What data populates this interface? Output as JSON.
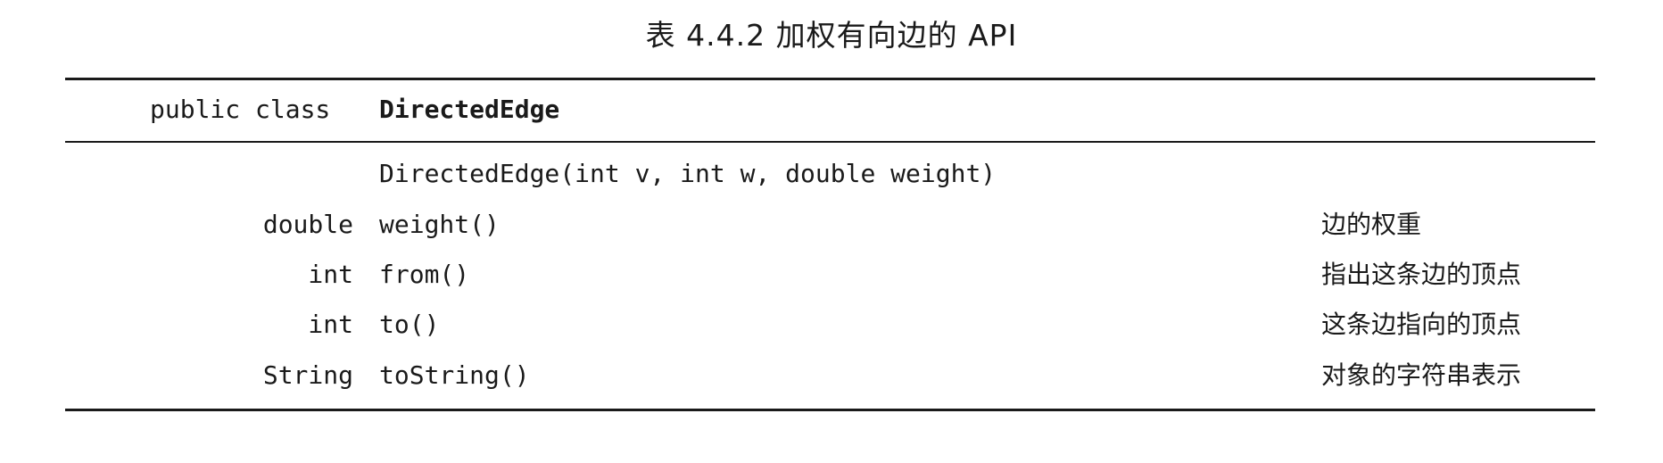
{
  "caption": "表 4.4.2 加权有向边的 API",
  "class_decl": {
    "keyword": "public class",
    "name": "DirectedEdge"
  },
  "constructor": {
    "signature": "DirectedEdge(int v, int w, double weight)"
  },
  "methods": [
    {
      "return_type": "double",
      "signature": "weight()",
      "description": "边的权重"
    },
    {
      "return_type": "int",
      "signature": "from()",
      "description": "指出这条边的顶点"
    },
    {
      "return_type": "int",
      "signature": "to()",
      "description": "这条边指向的顶点"
    },
    {
      "return_type": "String",
      "signature": "toString()",
      "description": "对象的字符串表示"
    }
  ]
}
